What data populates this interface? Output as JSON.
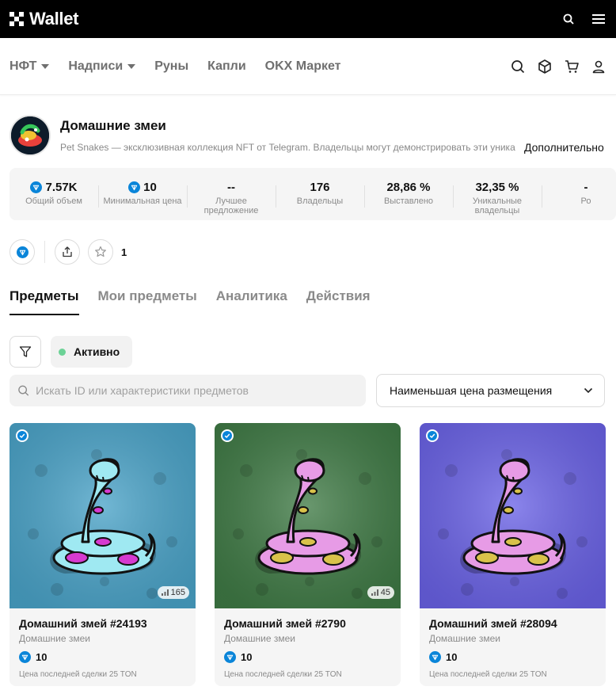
{
  "app": {
    "brand": "Wallet"
  },
  "topbar": {
    "icons": [
      "search-icon",
      "menu-icon"
    ]
  },
  "nav": {
    "items": [
      {
        "label": "НФТ",
        "dropdown": true
      },
      {
        "label": "Надписи",
        "dropdown": true
      },
      {
        "label": "Руны",
        "dropdown": false
      },
      {
        "label": "Капли",
        "dropdown": false
      },
      {
        "label": "OKX Маркет",
        "dropdown": false
      }
    ],
    "icons": [
      "search-icon",
      "cube-icon",
      "cart-icon",
      "user-icon"
    ]
  },
  "collection": {
    "title": "Домашние змеи",
    "description": "Pet Snakes — эксклюзивная коллекция NFT от Telegram. Владельцы могут демонстрировать эти уника",
    "more_label": "Дополнительно"
  },
  "stats": [
    {
      "value": "7.57K",
      "label": "Общий объем",
      "ton": true
    },
    {
      "value": "10",
      "label": "Минимальная цена",
      "ton": true
    },
    {
      "value": "--",
      "label": "Лучшее предложение",
      "ton": false
    },
    {
      "value": "176",
      "label": "Владельцы",
      "ton": false
    },
    {
      "value": "28,86 %",
      "label": "Выставлено",
      "ton": false
    },
    {
      "value": "32,35 %",
      "label": "Уникальные владельцы",
      "ton": false
    },
    {
      "value": "-",
      "label": "Ро",
      "ton": false
    }
  ],
  "actions": {
    "star_count": "1"
  },
  "tabs": [
    {
      "label": "Предметы",
      "active": true
    },
    {
      "label": "Мои предметы",
      "active": false
    },
    {
      "label": "Аналитика",
      "active": false
    },
    {
      "label": "Действия",
      "active": false
    }
  ],
  "filters": {
    "status_label": "Активно",
    "search_placeholder": "Искать ID или характеристики предметов",
    "sort_label": "Наименьшая цена размещения"
  },
  "colors": {
    "ton": "#0a85d9",
    "active_dot": "#6cd296"
  },
  "cards": [
    {
      "title": "Домашний змей #24193",
      "collection": "Домашние змеи",
      "price": "10",
      "last_sale": "Цена последней сделки 25 TON",
      "views": "165",
      "bg": "#4aa3c8",
      "snake_body": "#9fe9f2",
      "snake_spot": "#d63ad0"
    },
    {
      "title": "Домашний змей #2790",
      "collection": "Домашние змеи",
      "price": "10",
      "last_sale": "Цена последней сделки 25 TON",
      "views": "45",
      "bg": "#3f7a45",
      "snake_body": "#e79be6",
      "snake_spot": "#d9c24a"
    },
    {
      "title": "Домашний змей #28094",
      "collection": "Домашние змеи",
      "price": "10",
      "last_sale": "Цена последней сделки 25 TON",
      "views": "",
      "bg": "#6a62e6",
      "snake_body": "#e79be6",
      "snake_spot": "#d9c24a"
    }
  ]
}
